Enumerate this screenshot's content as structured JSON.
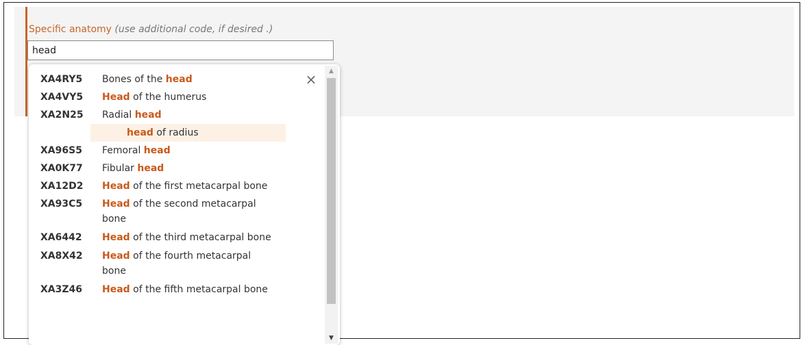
{
  "field": {
    "label": "Specific anatomy",
    "hint": "(use additional code, if desired .)",
    "value": "head"
  },
  "dropdown": {
    "close_icon": "×",
    "scroll_up_icon": "▲",
    "scroll_down_icon": "▼",
    "items": [
      {
        "code": "XA4RY5",
        "pre": "Bones of the ",
        "match": "head",
        "post": ""
      },
      {
        "code": "XA4VY5",
        "pre": "",
        "match": "Head",
        "post": " of the humerus"
      },
      {
        "code": "XA2N25",
        "pre": "Radial ",
        "match": "head",
        "post": ""
      },
      {
        "synonym_match": "head",
        "synonym_post": " of radius"
      },
      {
        "code": "XA96S5",
        "pre": "Femoral ",
        "match": "head",
        "post": ""
      },
      {
        "code": "XA0K77",
        "pre": "Fibular ",
        "match": "head",
        "post": ""
      },
      {
        "code": "XA12D2",
        "pre": "",
        "match": "Head",
        "post": " of the first metacarpal bone"
      },
      {
        "code": "XA93C5",
        "pre": "",
        "match": "Head",
        "post": " of the second metacarpal bone"
      },
      {
        "code": "XA6442",
        "pre": "",
        "match": "Head",
        "post": " of the third metacarpal bone"
      },
      {
        "code": "XA8X42",
        "pre": "",
        "match": "Head",
        "post": " of the fourth metacarpal bone"
      },
      {
        "code": "XA3Z46",
        "pre": "",
        "match": "Head",
        "post": " of the fifth metacarpal bone"
      }
    ]
  }
}
